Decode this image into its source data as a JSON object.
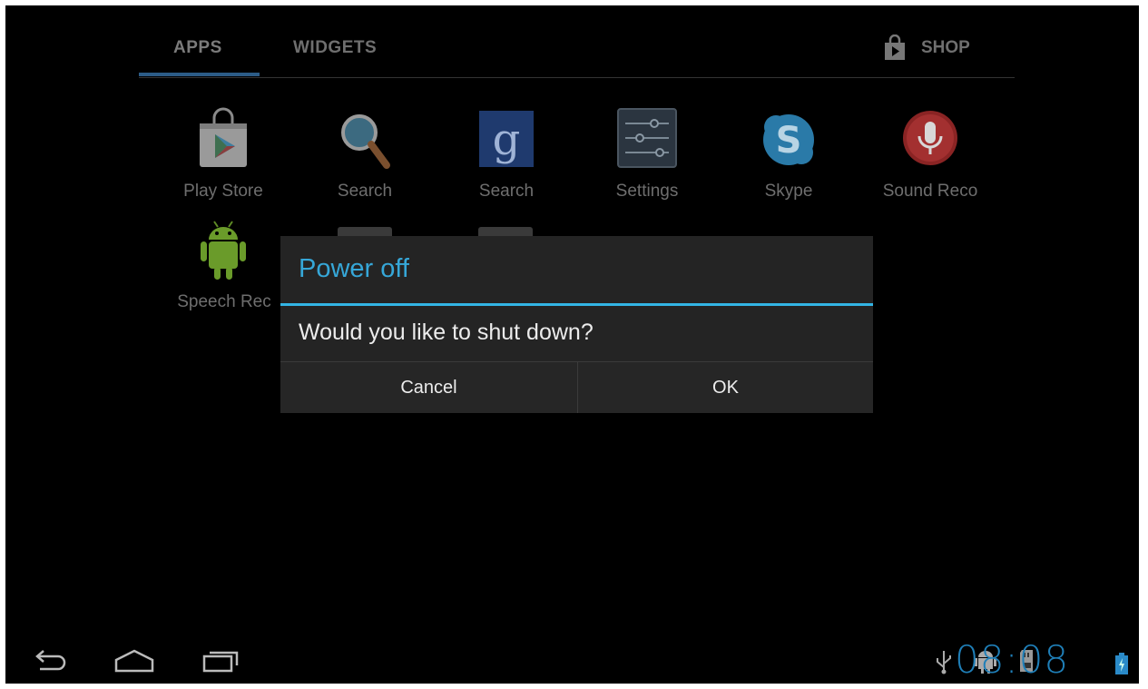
{
  "tabs": {
    "apps": "APPS",
    "widgets": "WIDGETS",
    "shop": "SHOP"
  },
  "apps": [
    {
      "label": "Play Store",
      "icon": "play-store-icon"
    },
    {
      "label": "Search",
      "icon": "magnifier-search-icon"
    },
    {
      "label": "Search",
      "icon": "google-search-icon"
    },
    {
      "label": "Settings",
      "icon": "settings-sliders-icon"
    },
    {
      "label": "Skype",
      "icon": "skype-icon"
    },
    {
      "label": "Sound Reco",
      "icon": "sound-recorder-mic-icon"
    },
    {
      "label": "Speech Rec",
      "icon": "android-robot-icon"
    }
  ],
  "dialog": {
    "title": "Power off",
    "message": "Would you like to shut down?",
    "cancel": "Cancel",
    "ok": "OK"
  },
  "status": {
    "time": "08:08"
  },
  "colors": {
    "accent": "#33b5e5",
    "clock": "#1f7fb8"
  }
}
